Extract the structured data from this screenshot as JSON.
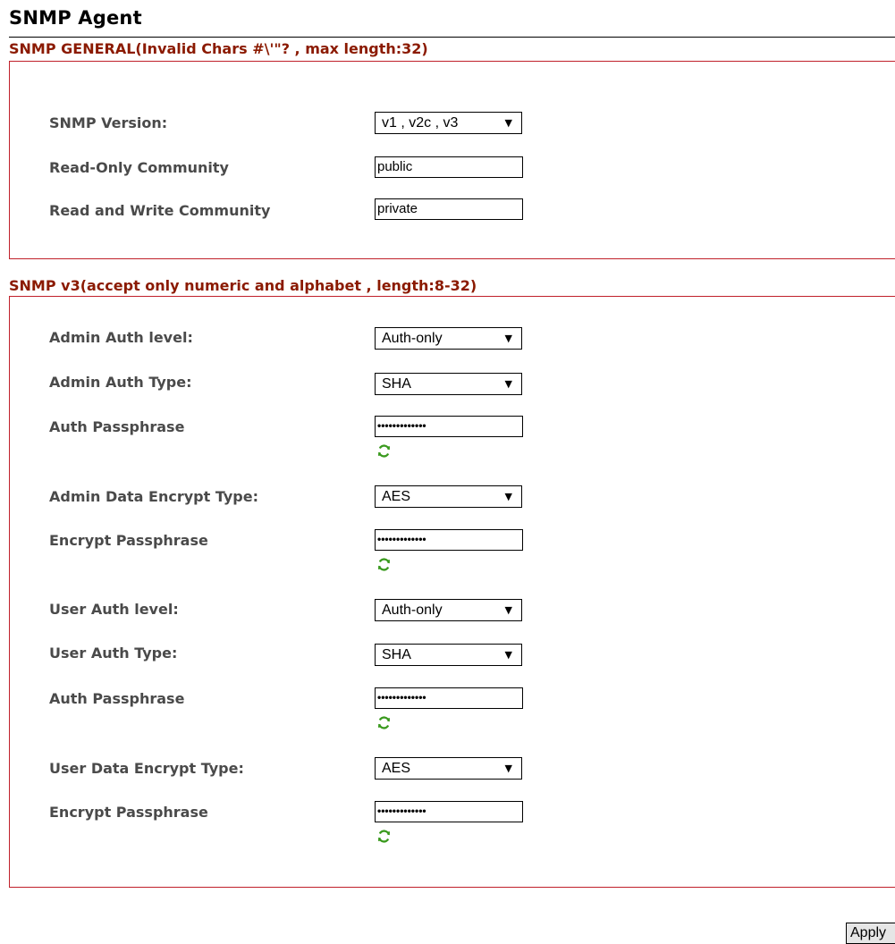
{
  "page": {
    "title": "SNMP Agent"
  },
  "general": {
    "title": "SNMP GENERAL(Invalid Chars #\\'\"? , max length:32)",
    "version_label": "SNMP Version:",
    "version_value": "v1 , v2c , v3",
    "ro_label": "Read-Only Community",
    "ro_value": "public",
    "rw_label": "Read and Write Community",
    "rw_value": "private"
  },
  "v3": {
    "title": "SNMP v3(accept only numeric and alphabet , length:8-32)",
    "admin_auth_level_label": "Admin Auth level:",
    "admin_auth_level_value": "Auth-only",
    "admin_auth_type_label": "Admin Auth Type:",
    "admin_auth_type_value": "SHA",
    "admin_auth_pass_label": "Auth Passphrase",
    "admin_auth_pass_value": "•••••••••••••",
    "admin_encrypt_type_label": "Admin Data Encrypt Type:",
    "admin_encrypt_type_value": "AES",
    "admin_encrypt_pass_label": "Encrypt Passphrase",
    "admin_encrypt_pass_value": "•••••••••••••",
    "user_auth_level_label": "User Auth level:",
    "user_auth_level_value": "Auth-only",
    "user_auth_type_label": "User Auth Type:",
    "user_auth_type_value": "SHA",
    "user_auth_pass_label": "Auth Passphrase",
    "user_auth_pass_value": "•••••••••••••",
    "user_encrypt_type_label": "User Data Encrypt Type:",
    "user_encrypt_type_value": "AES",
    "user_encrypt_pass_label": "Encrypt Passphrase",
    "user_encrypt_pass_value": "•••••••••••••"
  },
  "actions": {
    "apply_label": "Apply"
  },
  "colors": {
    "section_title": "#8b1a00",
    "section_border": "#c0202a",
    "refresh_icon": "#3a9a1e"
  }
}
